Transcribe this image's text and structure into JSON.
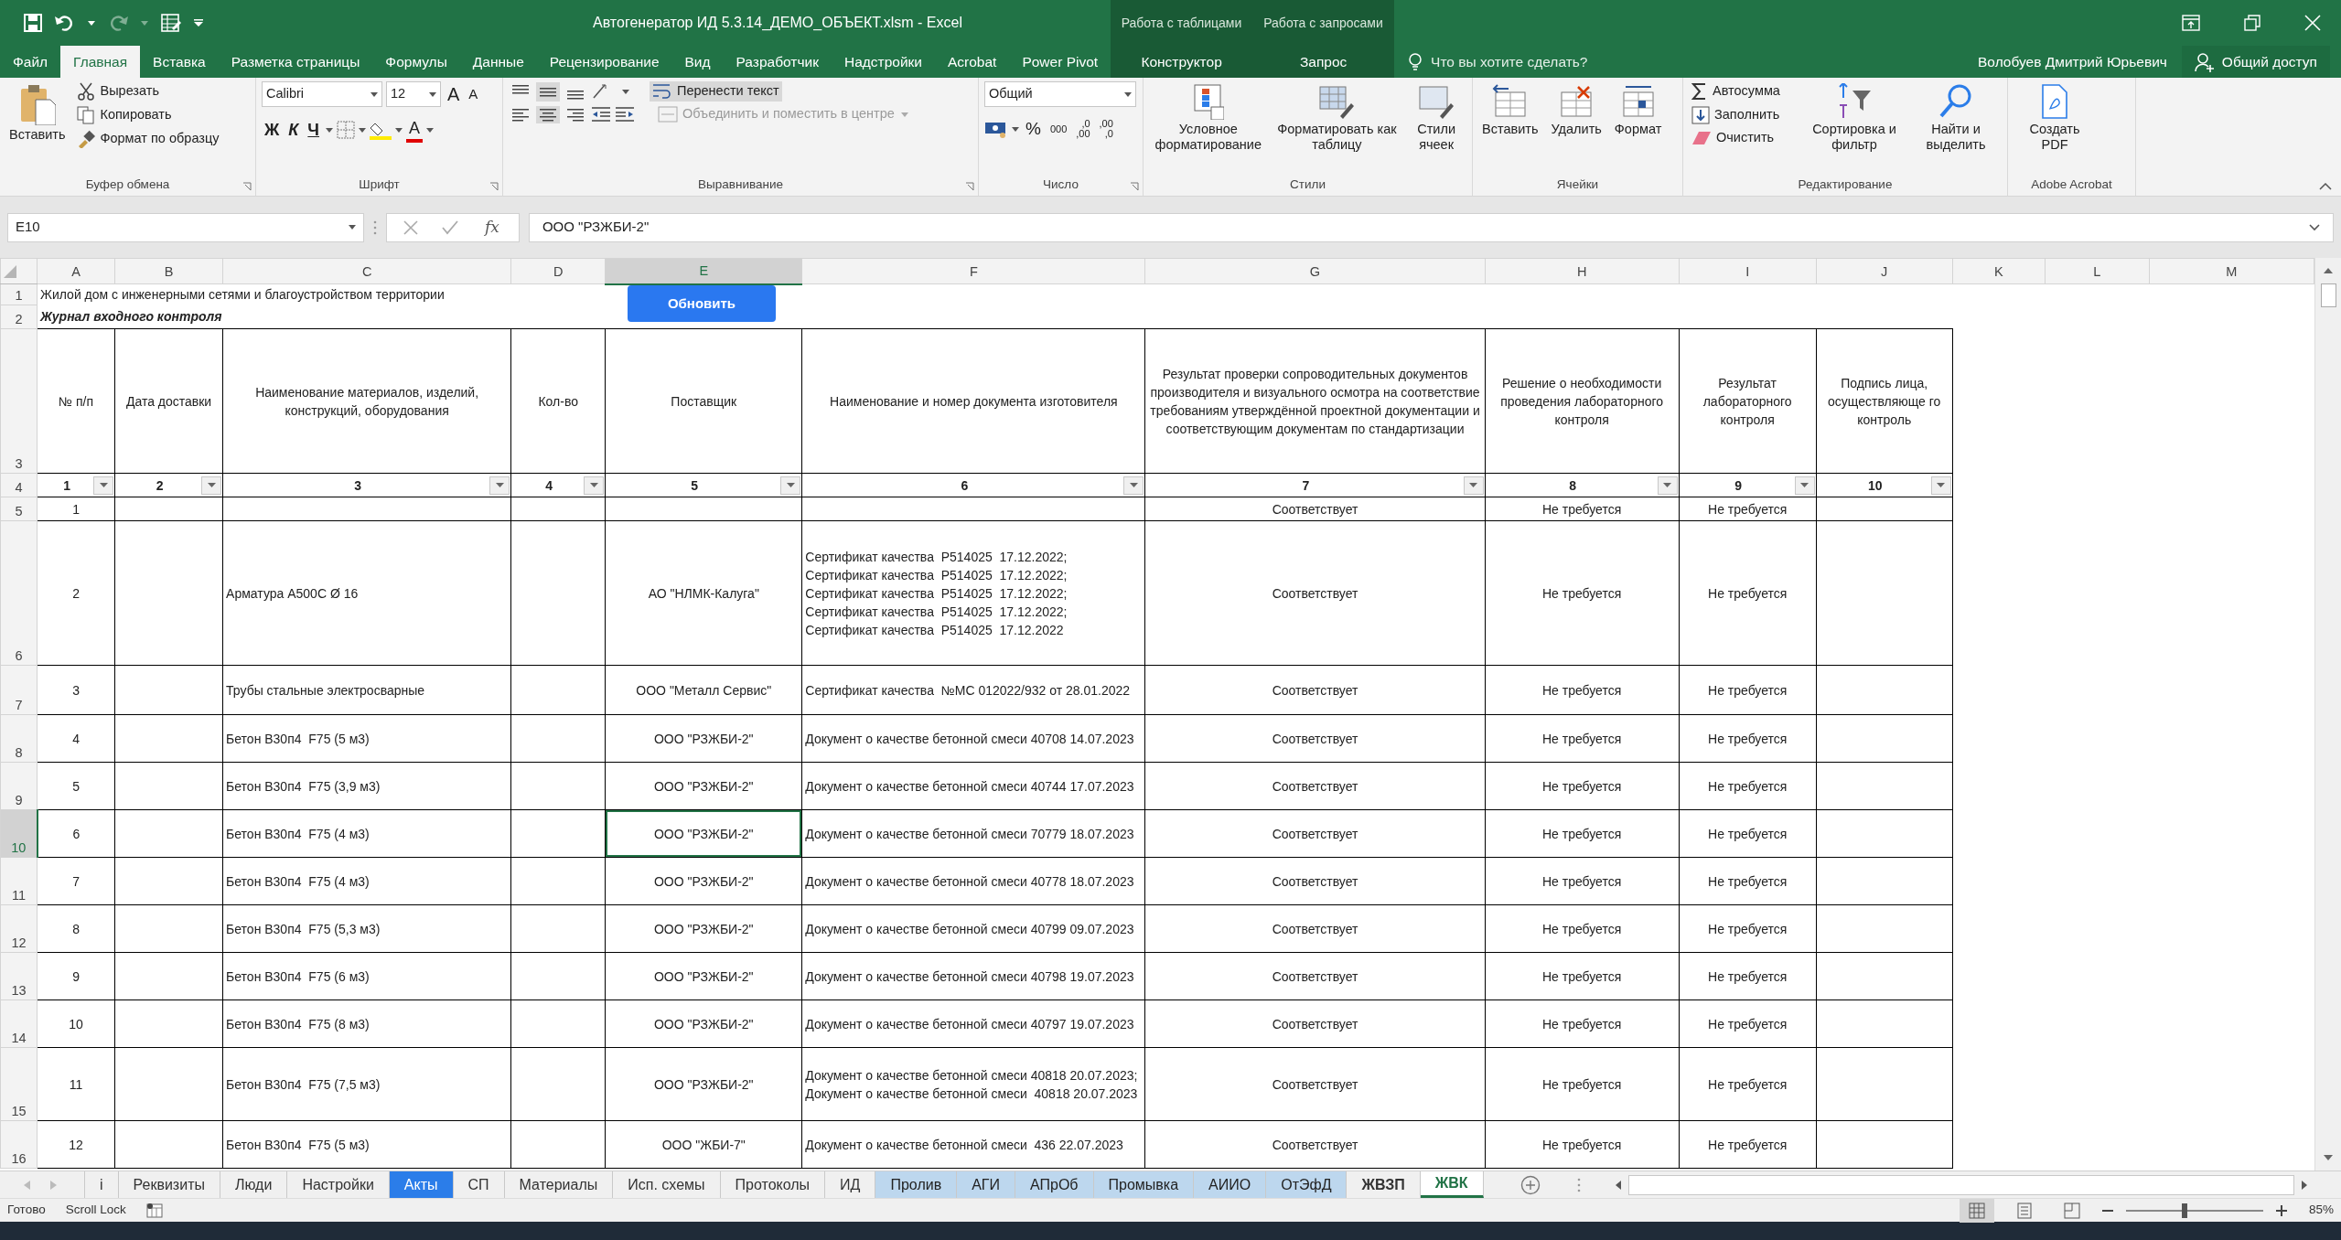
{
  "window": {
    "title": "Автогенератор ИД 5.3.14_ДЕМО_ОБЪЕКТ.xlsm - Excel"
  },
  "ribbon_tabs": [
    {
      "label": "Файл",
      "selected": false
    },
    {
      "label": "Главная",
      "selected": true
    },
    {
      "label": "Вставка",
      "selected": false
    },
    {
      "label": "Разметка страницы",
      "selected": false
    },
    {
      "label": "Формулы",
      "selected": false
    },
    {
      "label": "Данные",
      "selected": false
    },
    {
      "label": "Рецензирование",
      "selected": false
    },
    {
      "label": "Вид",
      "selected": false
    },
    {
      "label": "Разработчик",
      "selected": false
    },
    {
      "label": "Надстройки",
      "selected": false
    },
    {
      "label": "Acrobat",
      "selected": false
    },
    {
      "label": "Power Pivot",
      "selected": false
    },
    {
      "label": "Конструктор",
      "selected": false,
      "context": "Работа с таблицами"
    },
    {
      "label": "Запрос",
      "selected": false,
      "context": "Работа с запросами"
    }
  ],
  "tell_me": {
    "placeholder": "Что вы хотите сделать?"
  },
  "user": "Волобуев Дмитрий Юрьевич",
  "share_button": "Общий доступ",
  "ribbon": {
    "clipboard": {
      "label": "Буфер обмена",
      "paste": "Вставить",
      "cut": "Вырезать",
      "copy": "Копировать",
      "format_painter": "Формат по образцу"
    },
    "font": {
      "label": "Шрифт",
      "font_name": "Calibri",
      "font_size": "12",
      "grow": "A",
      "shrink": "A",
      "bold": "Ж",
      "italic": "К",
      "underline": "Ч",
      "font_color": "A"
    },
    "alignment": {
      "label": "Выравнивание",
      "vertical": [
        {
          "selected": false
        },
        {
          "selected": true
        },
        {
          "selected": false
        }
      ],
      "horizontal": [
        {
          "selected": false
        },
        {
          "selected": true
        },
        {
          "selected": false
        }
      ],
      "wrap_text": {
        "label": "Перенести текст",
        "on": true
      },
      "merge": {
        "label": "Объединить и поместить в центре",
        "disabled": true
      }
    },
    "number": {
      "label": "Число",
      "format": "Общий",
      "percent": "%",
      "thousands": "000",
      "decimals": [
        {
          "top": ",0",
          "bottom": ",00"
        },
        {
          "top": ",00",
          "bottom": ",0"
        }
      ]
    },
    "styles": {
      "label": "Стили",
      "conditional": "Условное форматирование",
      "as_table": "Форматировать как таблицу",
      "cell_styles": "Стили ячеек"
    },
    "cells": {
      "label": "Ячейки",
      "insert": "Вставить",
      "delete": "Удалить",
      "format": "Формат"
    },
    "editing": {
      "label": "Редактирование",
      "autosum": "Автосумма",
      "fill": "Заполнить",
      "clear": "Очистить",
      "sort": "Сортировка и фильтр",
      "find": "Найти и выделить"
    },
    "acrobat": {
      "label": "Adobe Acrobat",
      "create_pdf": "Создать PDF"
    }
  },
  "formula_bar": {
    "name_box": "E10",
    "function_glyph": "fx",
    "formula": "ООО \"РЗЖБИ-2\""
  },
  "sheet": {
    "refresh_button": "Обновить",
    "columns": [
      {
        "letter": "A",
        "selected": false
      },
      {
        "letter": "B",
        "selected": false
      },
      {
        "letter": "C",
        "selected": false
      },
      {
        "letter": "D",
        "selected": false
      },
      {
        "letter": "E",
        "selected": true
      },
      {
        "letter": "F",
        "selected": false
      },
      {
        "letter": "G",
        "selected": false
      },
      {
        "letter": "H",
        "selected": false
      },
      {
        "letter": "I",
        "selected": false
      },
      {
        "letter": "J",
        "selected": false
      },
      {
        "letter": "K",
        "selected": false
      },
      {
        "letter": "L",
        "selected": false
      },
      {
        "letter": "M",
        "selected": false
      }
    ],
    "rows": [
      {
        "number": "1",
        "kind": "title",
        "selected": false,
        "cells": {
          "A": "Жилой дом с инженерными сетями и благоустройством территории"
        }
      },
      {
        "number": "2",
        "kind": "heading",
        "selected": false,
        "cells": {
          "A": "Журнал входного контроля"
        }
      },
      {
        "number": "3",
        "kind": "header",
        "selected": false,
        "cells": {
          "A": "№ п/п",
          "B": "Дата доставки",
          "C": "Наименование материалов, изделий, конструкций, оборудования",
          "D": "Кол-во",
          "E": "Поставщик",
          "F": "Наименование и номер документа изготовителя",
          "G": "Результат проверки сопроводительных документов производителя и визуального осмотра на соответствие требованиям утверждённой проектной документации и соответствующим документам по стандартизации",
          "H": "Решение о необходимости проведения лабораторного контроля",
          "I": "Результат лабораторного контроля",
          "J": "Подпись лица, осуществляюще го контроль"
        }
      },
      {
        "number": "4",
        "kind": "index",
        "selected": false,
        "cells": {
          "A": {
            "text": "1",
            "filter": true
          },
          "B": {
            "text": "2",
            "filter": true
          },
          "C": {
            "text": "3",
            "filter": true
          },
          "D": {
            "text": "4",
            "filter": true
          },
          "E": {
            "text": "5",
            "filter": true
          },
          "F": {
            "text": "6",
            "filter": true
          },
          "G": {
            "text": "7",
            "filter": true
          },
          "H": {
            "text": "8",
            "filter": true
          },
          "I": {
            "text": "9",
            "filter": true
          },
          "J": {
            "text": "10",
            "filter": true
          }
        }
      },
      {
        "number": "5",
        "kind": "data",
        "selected": false,
        "cells": {
          "A": "1",
          "G": "Соответствует",
          "H": "Не требуется",
          "I": "Не требуется"
        }
      },
      {
        "number": "6",
        "kind": "data",
        "selected": false,
        "cells": {
          "A": "2",
          "C": "Арматура А500С Ø 16",
          "E": "АО \"НЛМК-Калуга\"",
          "F": "Сертификат качества  Р514025  17.12.2022; Сертификат качества  Р514025  17.12.2022; Сертификат качества  Р514025  17.12.2022; Сертификат качества  Р514025  17.12.2022; Сертификат качества  Р514025  17.12.2022",
          "G": "Соответствует",
          "H": "Не требуется",
          "I": "Не требуется"
        }
      },
      {
        "number": "7",
        "kind": "data",
        "selected": false,
        "cells": {
          "A": "3",
          "C": "Трубы стальные электросварные",
          "E": "ООО \"Металл Сервис\"",
          "F": "Сертификат качества  №МС 012022/932 от 28.01.2022",
          "G": "Соответствует",
          "H": "Не требуется",
          "I": "Не требуется"
        }
      },
      {
        "number": "8",
        "kind": "data",
        "selected": false,
        "cells": {
          "A": "4",
          "C": "Бетон В30п4  F75 (5 м3)",
          "E": "ООО \"РЗЖБИ-2\"",
          "F": "Документ о качестве бетонной смеси 40708 14.07.2023",
          "G": "Соответствует",
          "H": "Не требуется",
          "I": "Не требуется"
        }
      },
      {
        "number": "9",
        "kind": "data",
        "selected": false,
        "cells": {
          "A": "5",
          "C": "Бетон В30п4  F75 (3,9 м3)",
          "E": "ООО \"РЗЖБИ-2\"",
          "F": "Документ о качестве бетонной смеси 40744 17.07.2023",
          "G": "Соответствует",
          "H": "Не требуется",
          "I": "Не требуется"
        }
      },
      {
        "number": "10",
        "kind": "data",
        "selected": true,
        "cells": {
          "A": "6",
          "C": "Бетон В30п4  F75 (4 м3)",
          "E": "ООО \"РЗЖБИ-2\"",
          "F": "Документ о качестве бетонной смеси 70779 18.07.2023",
          "G": "Соответствует",
          "H": "Не требуется",
          "I": "Не требуется"
        }
      },
      {
        "number": "11",
        "kind": "data",
        "selected": false,
        "cells": {
          "A": "7",
          "C": "Бетон В30п4  F75 (4 м3)",
          "E": "ООО \"РЗЖБИ-2\"",
          "F": "Документ о качестве бетонной смеси 40778 18.07.2023",
          "G": "Соответствует",
          "H": "Не требуется",
          "I": "Не требуется"
        }
      },
      {
        "number": "12",
        "kind": "data",
        "selected": false,
        "cells": {
          "A": "8",
          "C": "Бетон В30п4  F75 (5,3 м3)",
          "E": "ООО \"РЗЖБИ-2\"",
          "F": "Документ о качестве бетонной смеси 40799 09.07.2023",
          "G": "Соответствует",
          "H": "Не требуется",
          "I": "Не требуется"
        }
      },
      {
        "number": "13",
        "kind": "data",
        "selected": false,
        "cells": {
          "A": "9",
          "C": "Бетон В30п4  F75 (6 м3)",
          "E": "ООО \"РЗЖБИ-2\"",
          "F": "Документ о качестве бетонной смеси 40798 19.07.2023",
          "G": "Соответствует",
          "H": "Не требуется",
          "I": "Не требуется"
        }
      },
      {
        "number": "14",
        "kind": "data",
        "selected": false,
        "cells": {
          "A": "10",
          "C": "Бетон В30п4  F75 (8 м3)",
          "E": "ООО \"РЗЖБИ-2\"",
          "F": "Документ о качестве бетонной смеси 40797 19.07.2023",
          "G": "Соответствует",
          "H": "Не требуется",
          "I": "Не требуется"
        }
      },
      {
        "number": "15",
        "kind": "data",
        "selected": false,
        "cells": {
          "A": "11",
          "C": "Бетон В30п4  F75 (7,5 м3)",
          "E": "ООО \"РЗЖБИ-2\"",
          "F": "Документ о качестве бетонной смеси 40818 20.07.2023; Документ о качестве бетонной смеси  40818 20.07.2023",
          "G": "Соответствует",
          "H": "Не требуется",
          "I": "Не требуется"
        }
      },
      {
        "number": "16",
        "kind": "data",
        "selected": false,
        "cells": {
          "A": "12",
          "C": "Бетон В30п4  F75 (5 м3)",
          "E": "ООО \"ЖБИ-7\"",
          "F": "Документ о качестве бетонной смеси  436 22.07.2023",
          "G": "Соответствует",
          "H": "Не требуется",
          "I": "Не требуется"
        }
      }
    ]
  },
  "sheet_tabs": [
    {
      "label": "i",
      "selected": false,
      "bold": false
    },
    {
      "label": "Реквизиты",
      "selected": false,
      "bold": false
    },
    {
      "label": "Люди",
      "selected": false,
      "bold": false
    },
    {
      "label": "Настройки",
      "selected": false,
      "bold": false
    },
    {
      "label": "Акты",
      "selected": false,
      "bold": false,
      "color": "#2b7de9"
    },
    {
      "label": "СП",
      "selected": false,
      "bold": false
    },
    {
      "label": "Материалы",
      "selected": false,
      "bold": false
    },
    {
      "label": "Исп. схемы",
      "selected": false,
      "bold": false
    },
    {
      "label": "Протоколы",
      "selected": false,
      "bold": false
    },
    {
      "label": "ИД",
      "selected": false,
      "bold": false
    },
    {
      "label": "Пролив",
      "selected": false,
      "bold": false,
      "color": "#bdd7ee"
    },
    {
      "label": "АГИ",
      "selected": false,
      "bold": false,
      "color": "#bdd7ee"
    },
    {
      "label": "АПрОб",
      "selected": false,
      "bold": false,
      "color": "#bdd7ee"
    },
    {
      "label": "Промывка",
      "selected": false,
      "bold": false,
      "color": "#bdd7ee"
    },
    {
      "label": "АИИО",
      "selected": false,
      "bold": false,
      "color": "#bdd7ee"
    },
    {
      "label": "ОтЭфД",
      "selected": false,
      "bold": false,
      "color": "#bdd7ee"
    },
    {
      "label": "ЖВЗП",
      "selected": false,
      "bold": true
    },
    {
      "label": "ЖВК",
      "selected": true,
      "bold": true
    }
  ],
  "status_bar": {
    "status": "Готово",
    "scroll_lock": "Scroll Lock",
    "views": [
      {
        "selected": true
      },
      {
        "selected": false
      },
      {
        "selected": false
      }
    ],
    "zoom": {
      "level": 0.43
    },
    "zoom_text": "85%"
  }
}
